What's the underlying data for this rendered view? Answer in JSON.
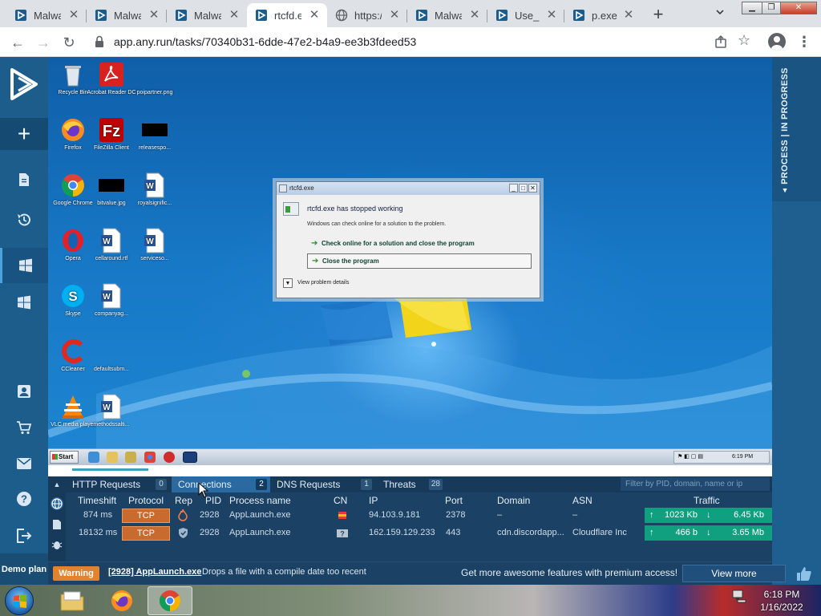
{
  "browser": {
    "tabs": [
      {
        "label": "Malwa",
        "favicon": "anyrun-icon",
        "active": false
      },
      {
        "label": "Malwa",
        "favicon": "anyrun-icon",
        "active": false
      },
      {
        "label": "Malwa",
        "favicon": "anyrun-icon",
        "active": false
      },
      {
        "label": "rtcfd.e",
        "favicon": "anyrun-icon",
        "active": true
      },
      {
        "label": "https:/",
        "favicon": "globe-icon",
        "active": false
      },
      {
        "label": "Malwa",
        "favicon": "anyrun-icon",
        "active": false
      },
      {
        "label": "Use_",
        "favicon": "anyrun-icon",
        "active": false
      },
      {
        "label": "p.exe",
        "favicon": "anyrun-icon",
        "active": false
      }
    ],
    "url": "app.any.run/tasks/70340b31-6dde-47e2-b4a9-ee3b3fdeed53"
  },
  "app": {
    "right_column": "PROCESS | IN PROGRESS",
    "demo_plan": "Demo plan"
  },
  "vm": {
    "desktop_icons": [
      {
        "label": "Recycle Bin"
      },
      {
        "label": "Acrobat Reader DC"
      },
      {
        "label": "poipartner.png"
      },
      {
        "label": "Firefox"
      },
      {
        "label": "FileZilla Client"
      },
      {
        "label": "releasespo..."
      },
      {
        "label": "Google Chrome"
      },
      {
        "label": "bitvalue.jpg"
      },
      {
        "label": "royalsignific..."
      },
      {
        "label": "Opera"
      },
      {
        "label": "cellaround.rtf"
      },
      {
        "label": "serviceso..."
      },
      {
        "label": "Skype"
      },
      {
        "label": "companyag..."
      },
      {
        "label": "CCleaner"
      },
      {
        "label": "defaultsubm..."
      },
      {
        "label": "VLC media player"
      },
      {
        "label": "methodssalti..."
      }
    ],
    "dialog": {
      "title": "rtcfd.exe",
      "heading": "rtcfd.exe has stopped working",
      "message": "Windows can check online for a solution to the problem.",
      "option1": "Check online for a solution and close the program",
      "option2": "Close the program",
      "details": "View problem details"
    },
    "taskbar": {
      "start": "Start",
      "clock": "6:19 PM"
    }
  },
  "panel": {
    "tabs": [
      {
        "label": "HTTP Requests",
        "count": "0"
      },
      {
        "label": "Connections",
        "count": "2",
        "active": true
      },
      {
        "label": "DNS Requests",
        "count": "1"
      },
      {
        "label": "Threats",
        "count": "28"
      }
    ],
    "filter_placeholder": "Filter by PID, domain, name or ip",
    "columns": [
      "Timeshift",
      "Protocol",
      "Rep",
      "PID",
      "Process name",
      "CN",
      "IP",
      "Port",
      "Domain",
      "ASN",
      "Traffic"
    ],
    "rows": [
      {
        "timeshift": "874 ms",
        "protocol": "TCP",
        "rep": "fire-icon",
        "pid": "2928",
        "process": "AppLaunch.exe",
        "cn": "flag-icon",
        "ip": "94.103.9.181",
        "port": "2378",
        "domain": "–",
        "asn": "–",
        "traffic_up": "1023 Kb",
        "traffic_down": "6.45 Kb"
      },
      {
        "timeshift": "18132 ms",
        "protocol": "TCP",
        "rep": "shield-icon",
        "pid": "2928",
        "process": "AppLaunch.exe",
        "cn": "unknown-flag-icon",
        "ip": "162.159.129.233",
        "port": "443",
        "domain": "cdn.discordapp...",
        "asn": "Cloudflare Inc",
        "traffic_up": "466 b",
        "traffic_down": "3.65 Mb"
      }
    ]
  },
  "status": {
    "badge": "Warning",
    "process": "[2928] AppLaunch.exe",
    "text": "Drops a file with a compile date too recent",
    "promo": "Get more awesome features with premium access!",
    "button": "View more"
  },
  "host": {
    "time": "6:18 PM",
    "date": "1/16/2022"
  },
  "colors": {
    "app_sidebar": "#1c5d8c",
    "panel_bg": "#1b4265",
    "tcp_badge": "#c96a2e",
    "traffic": "#10a07f",
    "warning": "#e4832d"
  }
}
